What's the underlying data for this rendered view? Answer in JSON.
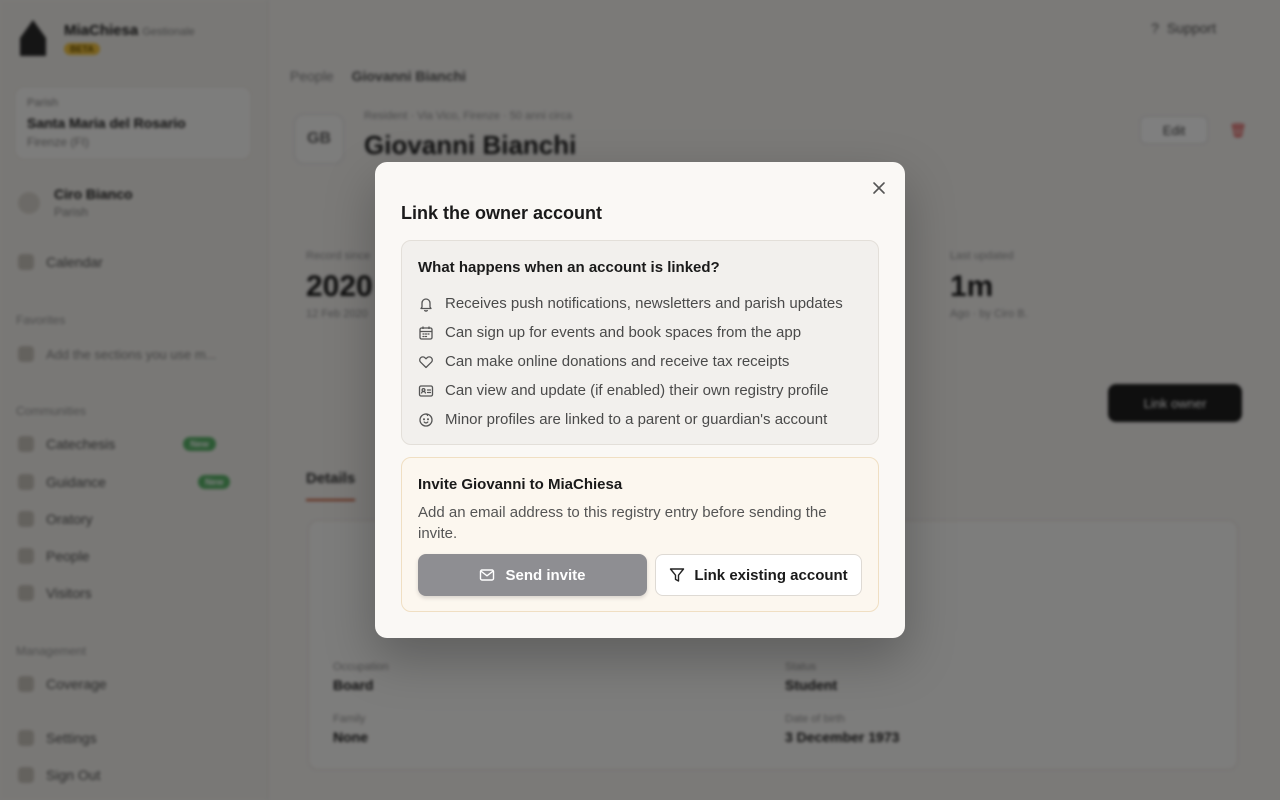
{
  "background": {
    "brand": {
      "name": "MiaChiesa",
      "sub": "Gestionale",
      "badge": "BETA"
    },
    "parish": {
      "label": "Parish",
      "name": "Santa Maria del Rosario",
      "city": "Firenze (FI)"
    },
    "user": {
      "name": "Ciro Bianco",
      "role": "Parish"
    },
    "nav": {
      "calendar": "Calendar",
      "favorites_label": "Favorites",
      "favorite_hint": "Add the sections you use m...",
      "community_label": "Communities",
      "items": [
        "Catechesis",
        "Guidance",
        "Oratory",
        "People",
        "Visitors"
      ],
      "pill": "New",
      "management_label": "Management",
      "coverage": "Coverage",
      "settings": "Settings",
      "signout": "Sign Out"
    },
    "support": "Support",
    "breadcrumb": {
      "root": "People",
      "current": "Giovanni Bianchi"
    },
    "person": {
      "initials": "GB",
      "meta": "Resident · Via Vico, Firenze · 50 anni circa",
      "name": "Giovanni Bianchi"
    },
    "edit": "Edit",
    "stats": [
      {
        "label": "Record since",
        "value": "2020",
        "sub": "12 Feb 2020"
      },
      {
        "label": "Last updated",
        "value": "1m",
        "sub": "Ago · by Ciro B."
      }
    ],
    "link_btn": "Link owner",
    "tab": "Details",
    "details": [
      {
        "label": "Occupation",
        "value": "Board"
      },
      {
        "label": "Status",
        "value": "Student"
      },
      {
        "label": "Family",
        "value": "None"
      },
      {
        "label": "Date of birth",
        "value": "3 December 1973"
      }
    ]
  },
  "modal": {
    "title": "Link the owner account",
    "close_icon": "close-icon",
    "info": {
      "title": "What happens when an account is linked?",
      "items": [
        {
          "icon": "bell-icon",
          "text": "Receives push notifications, newsletters and parish updates"
        },
        {
          "icon": "calendar-icon",
          "text": "Can sign up for events and book spaces from the app"
        },
        {
          "icon": "heart-icon",
          "text": "Can make online donations and receive tax receipts"
        },
        {
          "icon": "id-card-icon",
          "text": "Can view and update (if enabled) their own registry profile"
        },
        {
          "icon": "baby-icon",
          "text": "Minor profiles are linked to a parent or guardian's account"
        }
      ]
    },
    "invite": {
      "title": "Invite Giovanni to MiaChiesa",
      "description": "Add an email address to this registry entry before sending the invite.",
      "send_label": "Send invite",
      "link_label": "Link existing account"
    }
  }
}
